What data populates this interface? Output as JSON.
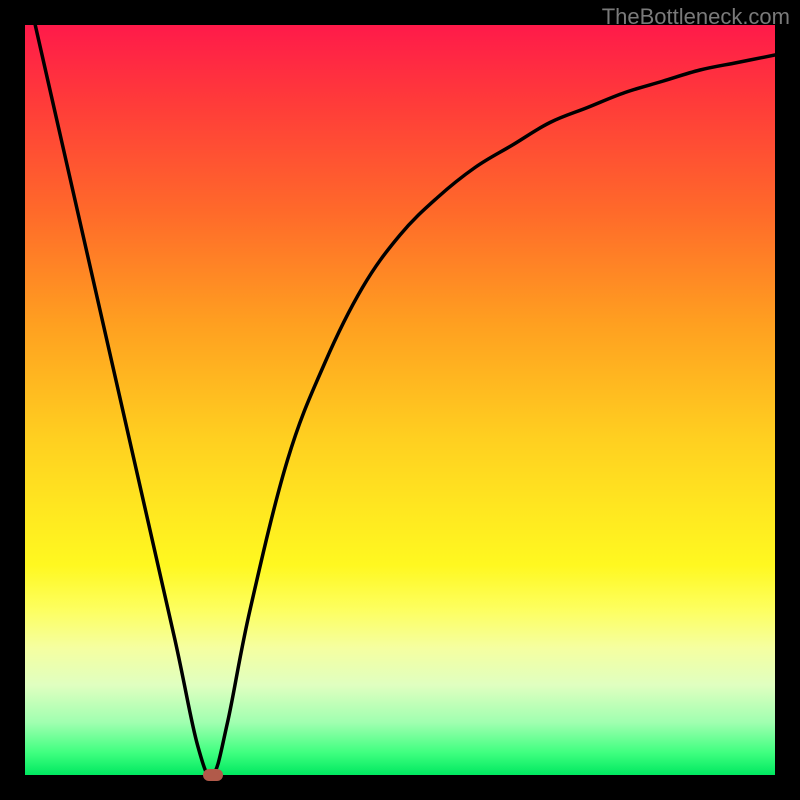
{
  "watermark": "TheBottleneck.com",
  "chart_data": {
    "type": "line",
    "title": "",
    "xlabel": "",
    "ylabel": "",
    "xlim": [
      0,
      100
    ],
    "ylim": [
      0,
      100
    ],
    "x": [
      0,
      5,
      10,
      15,
      20,
      23,
      25,
      27,
      30,
      35,
      40,
      45,
      50,
      55,
      60,
      65,
      70,
      75,
      80,
      85,
      90,
      95,
      100
    ],
    "y": [
      106,
      84,
      62,
      40,
      18,
      4,
      0,
      7,
      22,
      42,
      55,
      65,
      72,
      77,
      81,
      84,
      87,
      89,
      91,
      92.5,
      94,
      95,
      96
    ],
    "minimum": {
      "x": 25,
      "y": 0
    },
    "gradient_stops": [
      {
        "pos": 0,
        "color": "#ff1a4a"
      },
      {
        "pos": 25,
        "color": "#ff6a2a"
      },
      {
        "pos": 55,
        "color": "#ffcf20"
      },
      {
        "pos": 78,
        "color": "#fdff60"
      },
      {
        "pos": 100,
        "color": "#00e860"
      }
    ]
  }
}
